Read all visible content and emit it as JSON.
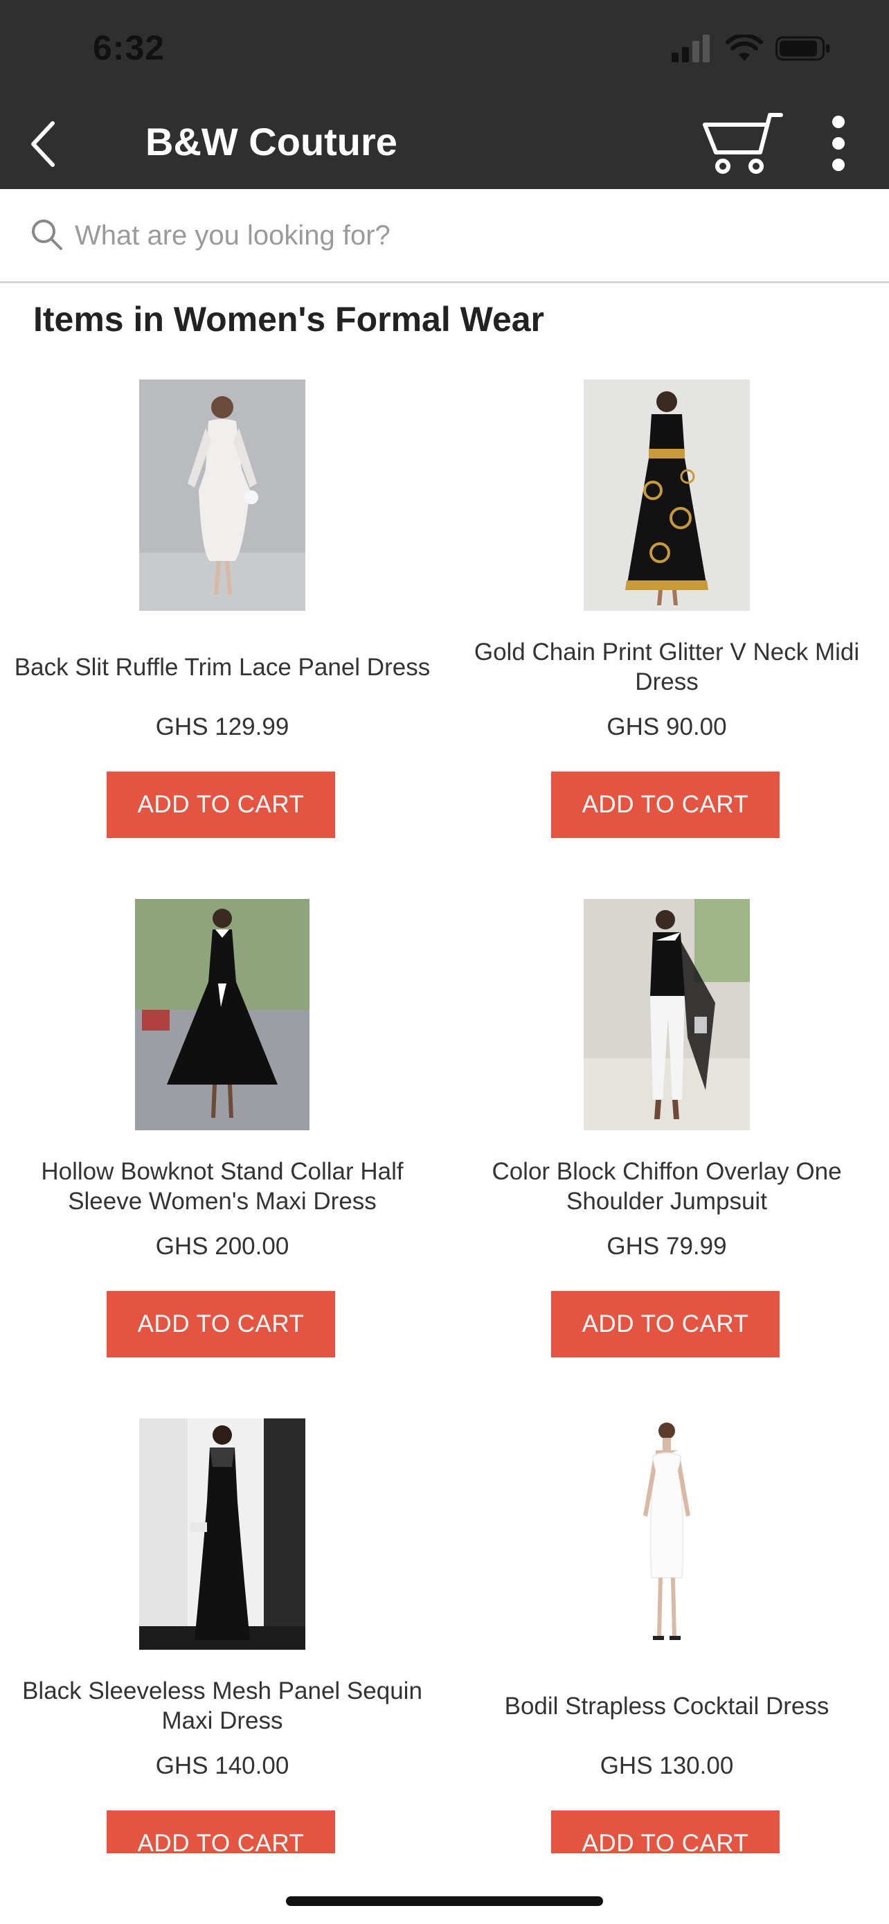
{
  "status_bar": {
    "time": "6:32"
  },
  "nav": {
    "title": "B&W Couture"
  },
  "search": {
    "placeholder": "What are you looking for?"
  },
  "section": {
    "title": "Items in Women's Formal Wear"
  },
  "products": [
    {
      "name": "Back Slit Ruffle Trim Lace Panel Dress",
      "price": "GHS 129.99",
      "button": "ADD TO CART"
    },
    {
      "name": "Gold Chain Print Glitter V Neck Midi Dress",
      "price": "GHS 90.00",
      "button": "ADD TO CART"
    },
    {
      "name": "Hollow Bowknot Stand Collar Half Sleeve Women's Maxi Dress",
      "price": "GHS 200.00",
      "button": "ADD TO CART"
    },
    {
      "name": "Color Block Chiffon Overlay One Shoulder Jumpsuit",
      "price": "GHS 79.99",
      "button": "ADD TO CART"
    },
    {
      "name": "Black Sleeveless Mesh Panel Sequin Maxi Dress",
      "price": "GHS 140.00",
      "button": "ADD TO CART"
    },
    {
      "name": "Bodil Strapless Cocktail Dress",
      "price": "GHS 130.00",
      "button": "ADD TO CART"
    }
  ],
  "colors": {
    "header_bg": "#2f2f2f",
    "button_bg": "#e55341"
  }
}
